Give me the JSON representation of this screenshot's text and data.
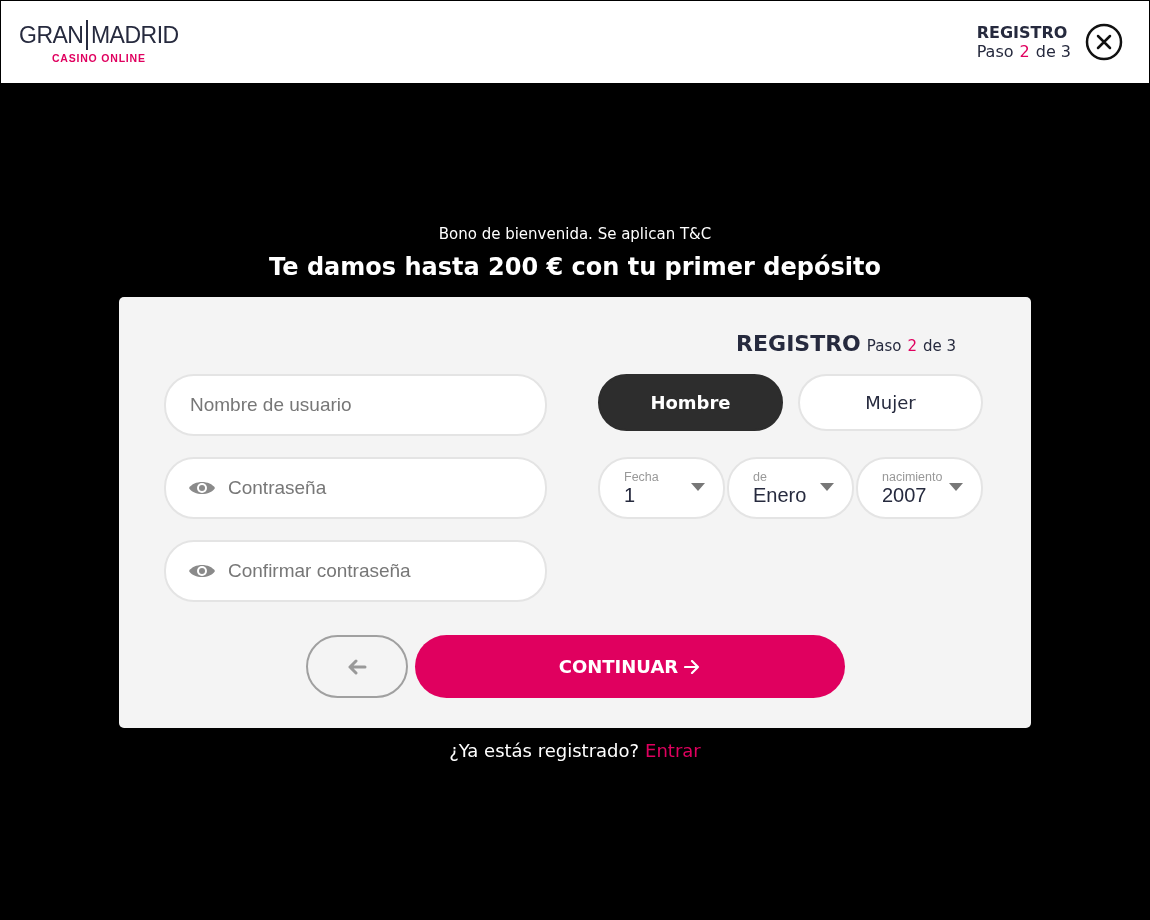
{
  "header": {
    "logo": {
      "left": "GRAN",
      "right": "MADRID",
      "tagline": "CASINO ONLINE"
    },
    "title": "REGISTRO",
    "step": {
      "label": "Paso",
      "current": "2",
      "of": "de 3"
    }
  },
  "promo": {
    "note": "Bono de bienvenida. Se aplican T&C",
    "headline": "Te damos hasta 200 € con tu primer depósito"
  },
  "form": {
    "title": "REGISTRO",
    "step": {
      "label": "Paso",
      "current": "2",
      "of": "de 3"
    },
    "fields": [
      {
        "kind": "text",
        "placeholder": "Nombre de usuario"
      },
      {
        "kind": "password",
        "placeholder": "Contraseña"
      },
      {
        "kind": "password",
        "placeholder": "Confirmar contraseña"
      }
    ],
    "gender": [
      {
        "label": "Hombre",
        "selected": true
      },
      {
        "label": "Mujer",
        "selected": false
      }
    ],
    "birthdate": [
      {
        "label": "Fecha",
        "value": "1"
      },
      {
        "label": "de",
        "value": "Enero"
      },
      {
        "label": "nacimiento",
        "value": "2007"
      }
    ],
    "continue_button": "CONTINUAR"
  },
  "footer": {
    "question": "¿Ya estás registrado?",
    "link": "Entrar"
  }
}
